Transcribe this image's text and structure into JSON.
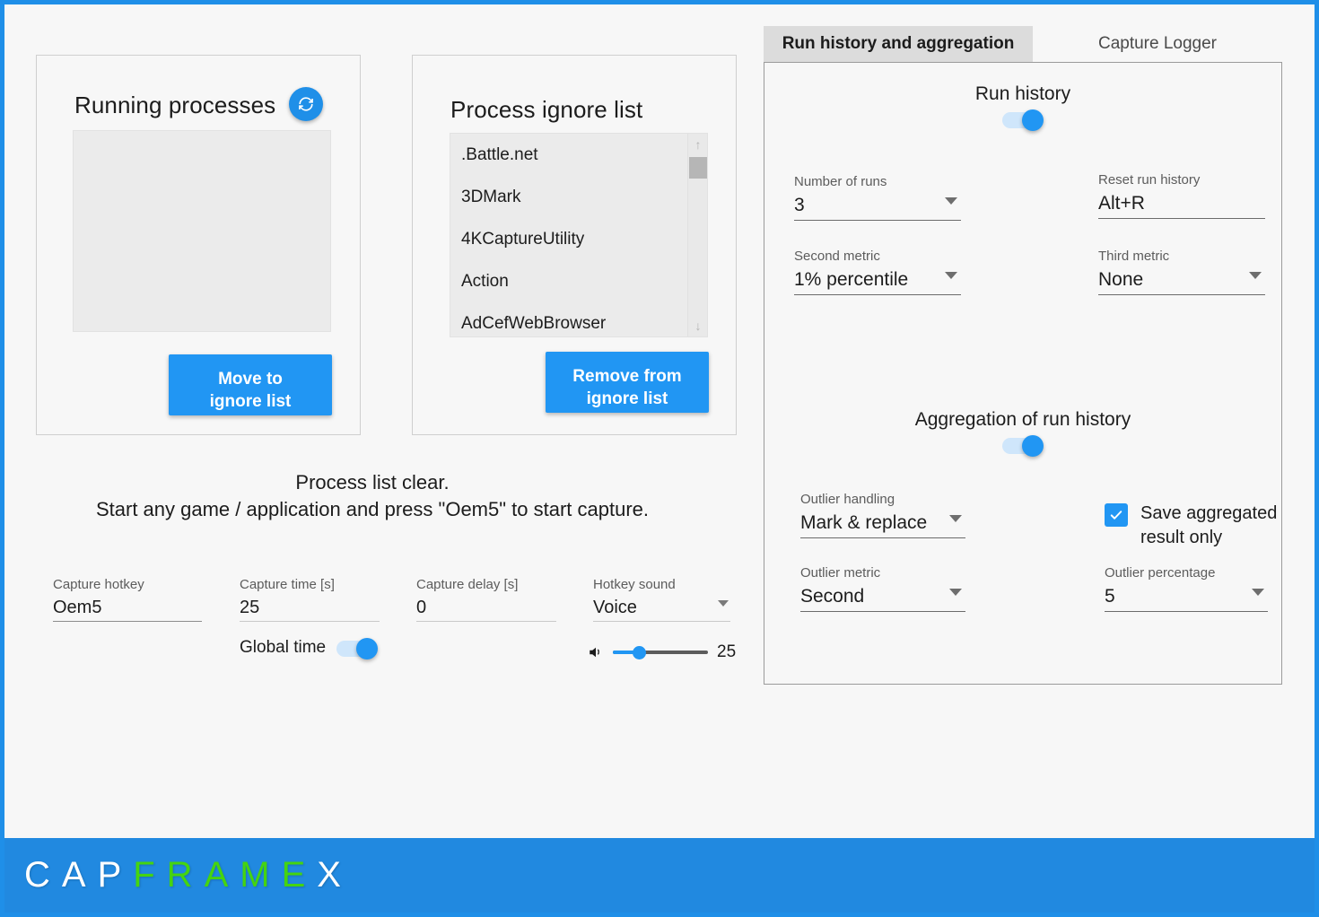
{
  "window": {
    "border_color": "#1f8fe8",
    "background": "#f7f7f7",
    "accent_color": "#2196f3"
  },
  "running_processes": {
    "title": "Running processes",
    "refresh_icon": "refresh-icon",
    "list_items": [],
    "move_button": "Move to\nignore list",
    "move_button_line1": "Move to",
    "move_button_line2": "ignore list"
  },
  "ignore_list": {
    "title": "Process ignore list",
    "items": [
      ".Battle.net",
      "3DMark",
      "4KCaptureUtility",
      "Action",
      "AdCefWebBrowser"
    ],
    "scroll_up_icon": "arrow-up-icon",
    "scroll_down_icon": "arrow-down-icon",
    "remove_button_line1": "Remove from",
    "remove_button_line2": "ignore list"
  },
  "status": {
    "line1": "Process list clear.",
    "line2": "Start any game / application and press \"Oem5\" to start capture."
  },
  "capture_settings": {
    "hotkey": {
      "label": "Capture hotkey",
      "value": "Oem5"
    },
    "time": {
      "label": "Capture time [s]",
      "value": "25"
    },
    "delay": {
      "label": "Capture delay [s]",
      "value": "0"
    },
    "sound": {
      "label": "Hotkey sound",
      "value": "Voice"
    },
    "global_time": {
      "label": "Global time",
      "state": "on"
    },
    "volume": {
      "value": "25",
      "percent": 25,
      "icon": "speaker-icon"
    }
  },
  "tabs": {
    "active": "Run history and aggregation",
    "inactive": "Capture Logger"
  },
  "run_history": {
    "section_title": "Run history",
    "toggle_state": "on",
    "number_of_runs": {
      "label": "Number of runs",
      "value": "3"
    },
    "reset_run_history": {
      "label": "Reset run history",
      "value": "Alt+R"
    },
    "second_metric": {
      "label": "Second metric",
      "value": "1% percentile"
    },
    "third_metric": {
      "label": "Third metric",
      "value": "None"
    }
  },
  "aggregation": {
    "section_title": "Aggregation of run history",
    "toggle_state": "on",
    "outlier_handling": {
      "label": "Outlier handling",
      "value": "Mark & replace"
    },
    "outlier_metric": {
      "label": "Outlier metric",
      "value": "Second"
    },
    "outlier_percentage": {
      "label": "Outlier percentage",
      "value": "5"
    },
    "save_aggregated": {
      "label": "Save aggregated result only",
      "checked": true
    }
  },
  "footer": {
    "logo_part1": "CAP",
    "logo_part2": "FRAME",
    "logo_part3": "X",
    "background": "#2189e0",
    "green": "#45d410"
  }
}
